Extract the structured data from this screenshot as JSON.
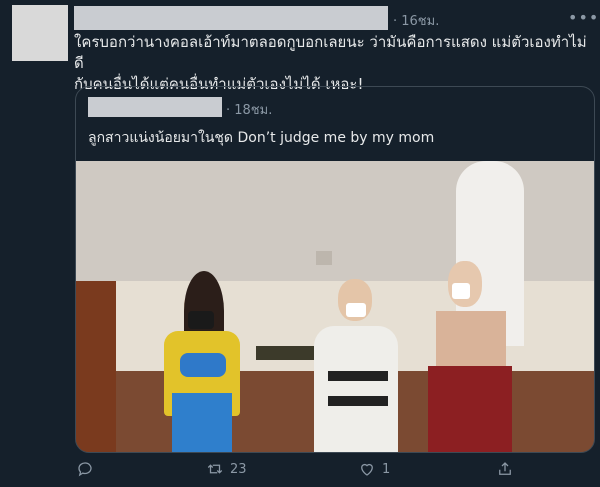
{
  "tweet": {
    "time": "· 16ชม.",
    "text_line1": "ใครบอกว่านางคอลเอ้าท์มาตลอดกูบอกเลยนะ ว่ามันคือการแสดง แม่ตัวเองทำไม่ดี",
    "text_line2": "กับคนอื่นได้แต่คนอื่นทำแม่ตัวเองไม่ได้ เหอะ!",
    "more_icon": "more-dots-icon"
  },
  "quoted_tweet": {
    "time": "· 18ชม.",
    "text": "ลูกสาวแน่งน้อยมาในชุด Don’t judge me by my mom"
  },
  "actions": {
    "reply_count": "",
    "retweet_count": "23",
    "like_count": "1"
  }
}
